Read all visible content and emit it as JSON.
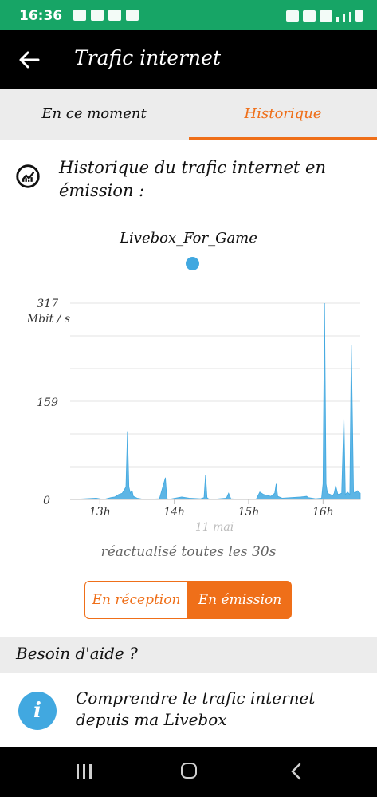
{
  "status_bar": {
    "time": "16:36"
  },
  "app_bar": {
    "title": "Trafic internet"
  },
  "tabs": [
    {
      "label": "En ce moment",
      "active": false
    },
    {
      "label": "Historique",
      "active": true
    }
  ],
  "section": {
    "title": "Historique du trafic internet en émission :"
  },
  "legend": {
    "label": "Livebox_For_Game",
    "color": "#41a8e0"
  },
  "chart_data": {
    "type": "area",
    "ylabel": "Mbit / s",
    "ylim": [
      0,
      317
    ],
    "yticks": [
      317,
      159,
      0
    ],
    "xticks": [
      "13h",
      "14h",
      "15h",
      "16h"
    ],
    "xlabel": "11 mai",
    "xlim": [
      12.6,
      16.5
    ],
    "grid": true,
    "series": [
      {
        "name": "Livebox_For_Game",
        "color": "#41a8e0",
        "x": [
          12.6,
          12.8,
          12.95,
          13.05,
          13.15,
          13.2,
          13.25,
          13.3,
          13.35,
          13.37,
          13.39,
          13.41,
          13.43,
          13.45,
          13.5,
          13.6,
          13.8,
          13.88,
          13.9,
          13.92,
          14.1,
          14.2,
          14.35,
          14.4,
          14.42,
          14.44,
          14.46,
          14.5,
          14.7,
          14.73,
          14.76,
          14.9,
          15.1,
          15.15,
          15.2,
          15.3,
          15.35,
          15.37,
          15.39,
          15.45,
          15.7,
          15.78,
          15.8,
          15.9,
          15.98,
          16.0,
          16.02,
          16.04,
          16.06,
          16.1,
          16.13,
          16.15,
          16.17,
          16.2,
          16.25,
          16.28,
          16.3,
          16.33,
          16.36,
          16.38,
          16.41,
          16.43,
          16.46,
          16.5
        ],
        "values": [
          0,
          1,
          2,
          0,
          3,
          4,
          8,
          10,
          20,
          110,
          20,
          10,
          15,
          5,
          2,
          0,
          1,
          35,
          2,
          0,
          4,
          2,
          1,
          3,
          40,
          3,
          1,
          0,
          2,
          10,
          1,
          0,
          0,
          12,
          8,
          5,
          10,
          25,
          5,
          2,
          4,
          5,
          3,
          1,
          2,
          25,
          320,
          25,
          10,
          8,
          6,
          10,
          22,
          8,
          10,
          135,
          8,
          12,
          8,
          250,
          12,
          10,
          14,
          10
        ]
      }
    ]
  },
  "refresh_text": "réactualisé toutes les 30s",
  "toggle": {
    "left_label": "En réception",
    "right_label": "En émission",
    "active": "right"
  },
  "help": {
    "heading": "Besoin d'aide ?",
    "item_text": "Comprendre le trafic internet depuis ma Livebox"
  },
  "colors": {
    "status_bar": "#17a566",
    "accent": "#ef6f19",
    "series": "#41a8e0"
  }
}
